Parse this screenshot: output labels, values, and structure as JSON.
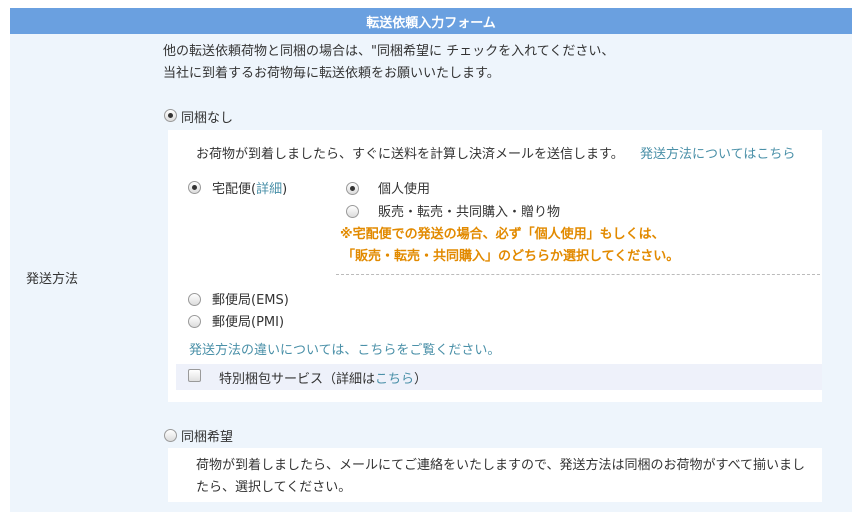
{
  "form": {
    "title": "転送依頼入力フォーム",
    "field_label": "発送方法",
    "intro_line1": "他の転送依頼荷物と同梱の場合は、\"同梱希望に チェックを入れてください、",
    "intro_line2": "当社に到着するお荷物毎に転送依頼をお願いいたします。",
    "no_bundle": {
      "label": "同梱なし",
      "selected": true,
      "description": "お荷物が到着しましたら、すぐに送料を計算し決済メールを送信します。",
      "shipping_info_link": "発送方法についてはこちら",
      "takuhaibin": {
        "label_prefix": "宅配便(",
        "detail_link": "詳細",
        "label_suffix": ")",
        "selected": true,
        "usage_options": [
          {
            "label": "個人使用",
            "selected": true
          },
          {
            "label": "販売・転売・共同購入・贈り物",
            "selected": false
          }
        ],
        "warning_line1": "※宅配便での発送の場合、必ず「個人使用」もしくは、",
        "warning_line2": "「販売・転売・共同購入」のどちらか選択してください。"
      },
      "post_options": [
        {
          "label": "郵便局(EMS)",
          "selected": false
        },
        {
          "label": "郵便局(PMI)",
          "selected": false
        }
      ],
      "difference_link": "発送方法の違いについては、こちらをご覧ください。",
      "special_packing": {
        "label_prefix": "特別梱包サービス（詳細は",
        "link": "こちら",
        "label_suffix": "）",
        "checked": false
      }
    },
    "bundle": {
      "label": "同梱希望",
      "selected": false,
      "description_line1": "荷物が到着しましたら、メールにてご連絡をいたしますので、発送方法は同梱のお荷物がすべて揃いまし",
      "description_line2": "たら、選択してください。"
    }
  }
}
